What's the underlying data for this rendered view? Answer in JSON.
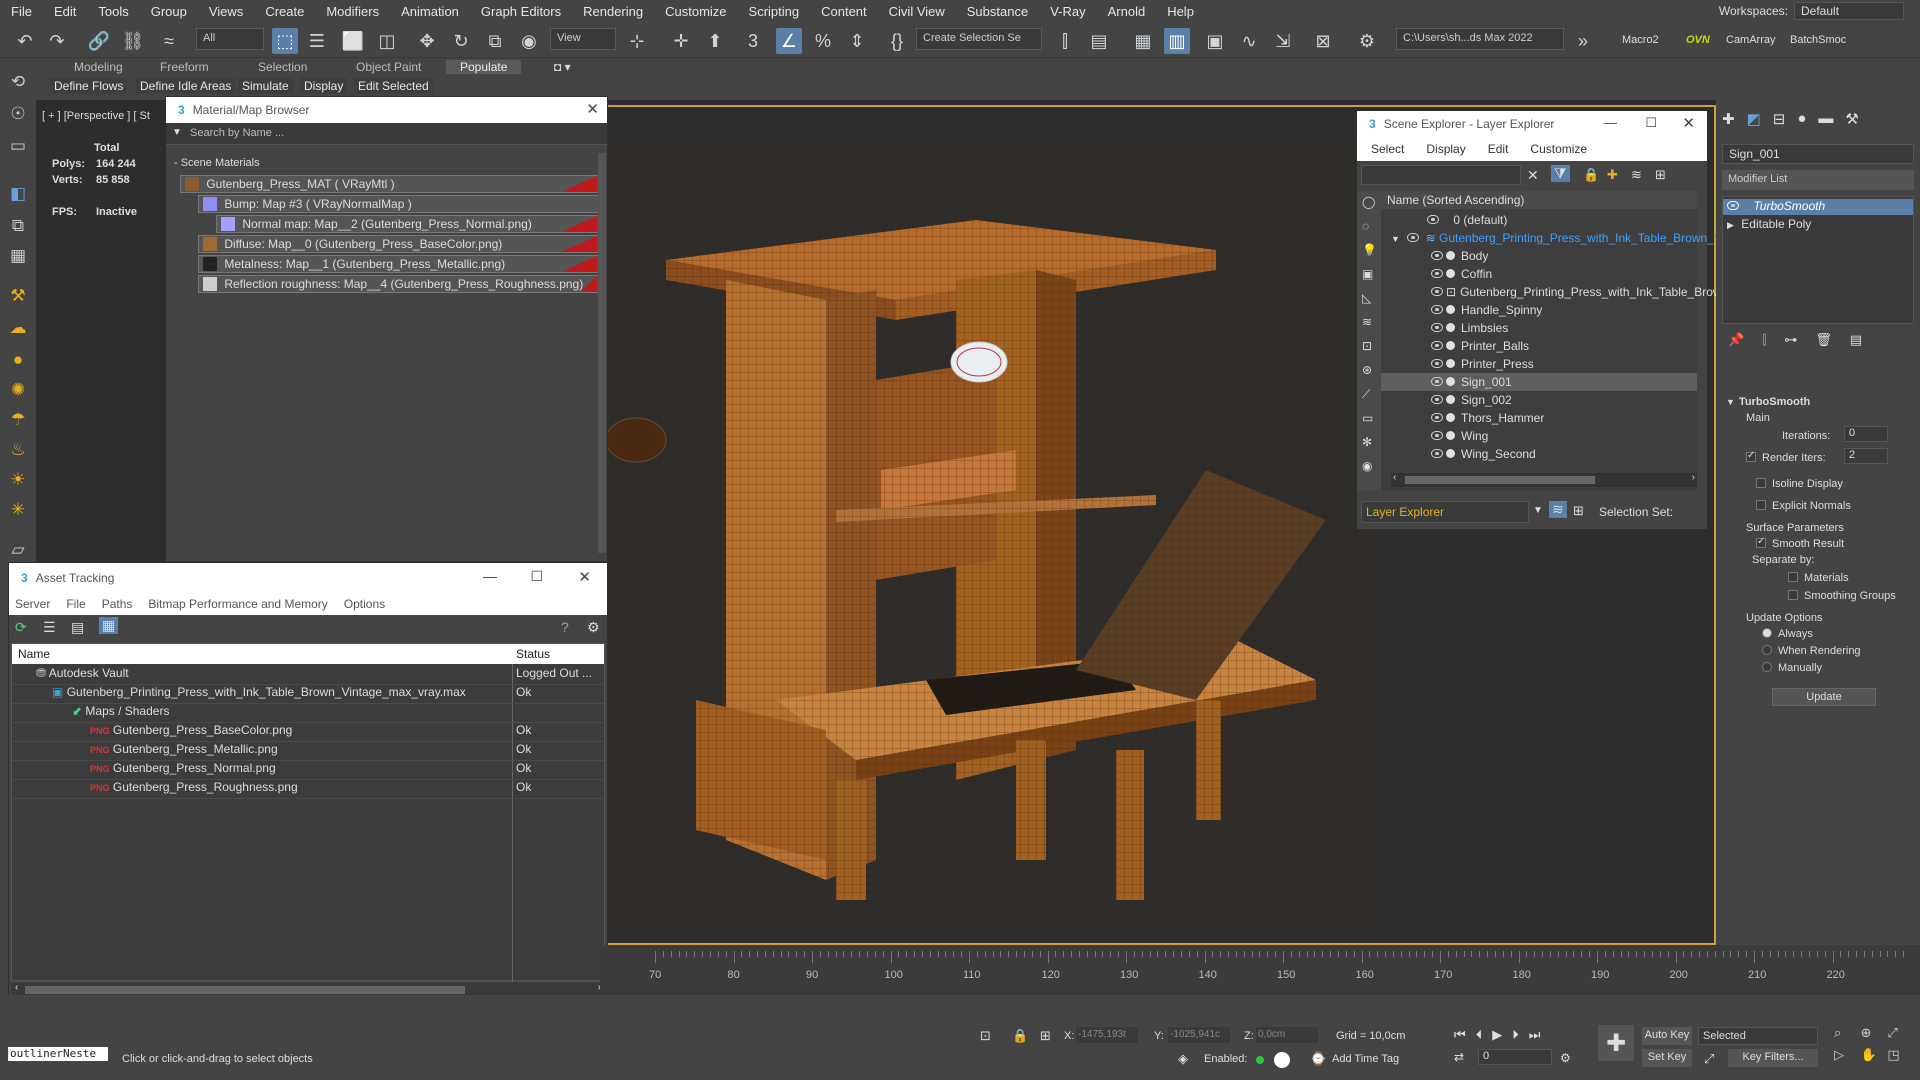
{
  "menubar": {
    "items": [
      "File",
      "Edit",
      "Tools",
      "Group",
      "Views",
      "Create",
      "Modifiers",
      "Animation",
      "Graph Editors",
      "Rendering",
      "Customize",
      "Scripting",
      "Content",
      "Civil View",
      "Substance",
      "V-Ray",
      "Arnold",
      "Help"
    ],
    "workspaces_label": "Workspaces:",
    "workspace_value": "Default"
  },
  "toolbar": {
    "filter_value": "All",
    "view_value": "View",
    "create_selection": "Create Selection Se",
    "path_value": "C:\\Users\\sh...ds Max 2022",
    "macro2": "Macro2",
    "ovn": "OVN",
    "camarray": "CamArray",
    "batchsmoc": "BatchSmoc",
    "snap3": "3"
  },
  "ribbon": {
    "tabs": [
      "Modeling",
      "Freeform",
      "Selection",
      "Object Paint",
      "Populate"
    ],
    "buttons": [
      "Define Flows",
      "Define Idle Areas",
      "Simulate",
      "Display",
      "Edit Selected"
    ]
  },
  "viewport": {
    "label": "[ + ] [Perspective ] [ St",
    "stats_total": "Total",
    "polys_label": "Polys:",
    "polys_value": "164 244",
    "verts_label": "Verts:",
    "verts_value": "85 858",
    "fps_label": "FPS:",
    "fps_value": "Inactive"
  },
  "material_browser": {
    "title": "Material/Map Browser",
    "search_placeholder": "Search by Name ...",
    "group": "- Scene Materials",
    "items": [
      {
        "label": "Gutenberg_Press_MAT  ( VRayMtl )",
        "indent": 0
      },
      {
        "label": "Bump: Map #3  ( VRayNormalMap )",
        "indent": 1
      },
      {
        "label": "Normal map: Map__2 (Gutenberg_Press_Normal.png)",
        "indent": 2
      },
      {
        "label": "Diffuse: Map__0 (Gutenberg_Press_BaseColor.png)",
        "indent": 1
      },
      {
        "label": "Metalness: Map__1 (Gutenberg_Press_Metallic.png)",
        "indent": 1
      },
      {
        "label": "Reflection roughness: Map__4 (Gutenberg_Press_Roughness.png)",
        "indent": 1
      }
    ]
  },
  "asset_tracking": {
    "title": "Asset Tracking",
    "menu": [
      "Server",
      "File",
      "Paths",
      "Bitmap Performance and Memory",
      "Options"
    ],
    "col_name": "Name",
    "col_status": "Status",
    "rows": [
      {
        "name": "Autodesk Vault",
        "status": "Logged Out ...",
        "indent": 1
      },
      {
        "name": "Gutenberg_Printing_Press_with_Ink_Table_Brown_Vintage_max_vray.max",
        "status": "Ok",
        "indent": 2
      },
      {
        "name": "Maps / Shaders",
        "status": "",
        "indent": 3
      },
      {
        "name": "Gutenberg_Press_BaseColor.png",
        "status": "Ok",
        "indent": 4
      },
      {
        "name": "Gutenberg_Press_Metallic.png",
        "status": "Ok",
        "indent": 4
      },
      {
        "name": "Gutenberg_Press_Normal.png",
        "status": "Ok",
        "indent": 4
      },
      {
        "name": "Gutenberg_Press_Roughness.png",
        "status": "Ok",
        "indent": 4
      }
    ]
  },
  "scene_explorer": {
    "title": "Scene Explorer - Layer Explorer",
    "menu": [
      "Select",
      "Display",
      "Edit",
      "Customize"
    ],
    "col_header": "Name (Sorted Ascending)",
    "layer_default": "0 (default)",
    "layer_main": "Gutenberg_Printing_Press_with_Ink_Table_Brown_V",
    "objects": [
      "Body",
      "Coffin",
      "Gutenberg_Printing_Press_with_Ink_Table_Brow",
      "Handle_Spinny",
      "Limbsies",
      "Printer_Balls",
      "Printer_Press",
      "Sign_001",
      "Sign_002",
      "Thors_Hammer",
      "Wing",
      "Wing_Second"
    ],
    "selected": "Sign_001",
    "footer_dropdown": "Layer Explorer",
    "selection_set": "Selection Set:"
  },
  "command_panel": {
    "object_name": "Sign_001",
    "modifier_list": "Modifier List",
    "stack": [
      "TurboSmooth",
      "Editable Poly"
    ],
    "rollout": "TurboSmooth",
    "main": "Main",
    "iterations_label": "Iterations:",
    "iterations_value": "0",
    "render_iters_label": "Render Iters:",
    "render_iters_value": "2",
    "isoline": "Isoline Display",
    "explicit_normals": "Explicit Normals",
    "surface_params": "Surface Parameters",
    "smooth_result": "Smooth Result",
    "separate_by": "Separate by:",
    "materials": "Materials",
    "smoothing_groups": "Smoothing Groups",
    "update_options": "Update Options",
    "always": "Always",
    "when_rendering": "When Rendering",
    "manually": "Manually",
    "update_btn": "Update"
  },
  "timeline": {
    "ticks": [
      "70",
      "80",
      "90",
      "100",
      "110",
      "120",
      "130",
      "140",
      "150",
      "160",
      "170",
      "180",
      "190",
      "200",
      "210",
      "220"
    ]
  },
  "status": {
    "listener": "outlinerNeste",
    "prompt": "Click or click-and-drag to select objects",
    "x_label": "X:",
    "x_value": "-1475,193t",
    "y_label": "Y:",
    "y_value": "-1025,941c",
    "z_label": "Z:",
    "z_value": "0,0cm",
    "grid": "Grid = 10,0cm",
    "enabled": "Enabled:",
    "add_time_tag": "Add Time Tag",
    "auto_key": "Auto Key",
    "selected": "Selected",
    "set_key": "Set Key",
    "key_filters": "Key Filters...",
    "frame": "0"
  },
  "colors": {
    "accent": "#c9a23a",
    "selection": "#5a7fa8",
    "red": "#c0191b",
    "layer_link": "#3da0ff"
  }
}
